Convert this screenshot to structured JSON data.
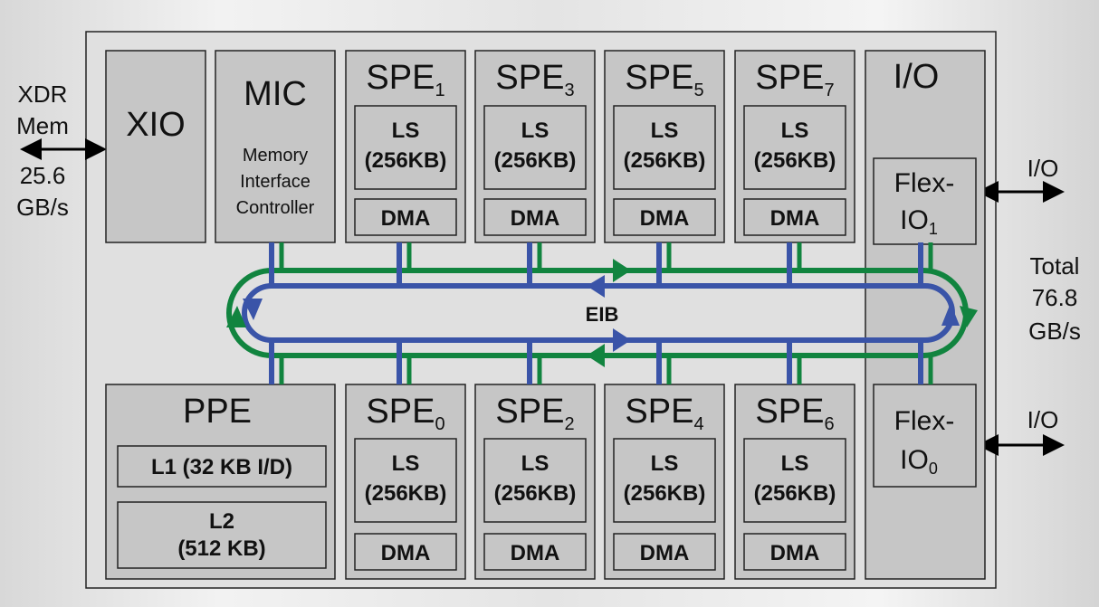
{
  "left": {
    "line1": "XDR",
    "line2": "Mem",
    "line3": "25.6",
    "line4": "GB/s"
  },
  "right": {
    "io_top": "I/O",
    "io_bottom": "I/O",
    "total1": "Total",
    "total2": "76.8",
    "total3": "GB/s"
  },
  "xio": "XIO",
  "mic": {
    "title": "MIC",
    "line1": "Memory",
    "line2": "Interface",
    "line3": "Controller"
  },
  "spe_prefix": "SPE",
  "spes_top": [
    "1",
    "3",
    "5",
    "7"
  ],
  "spes_bottom": [
    "0",
    "2",
    "4",
    "6"
  ],
  "ls": {
    "line1": "LS",
    "line2": "(256KB)"
  },
  "dma": "DMA",
  "io": {
    "title": "I/O",
    "flex": "Flex-",
    "io": "IO",
    "sub_top": "1",
    "sub_bottom": "0"
  },
  "ppe": {
    "title": "PPE",
    "l1": "L1 (32 KB I/D)",
    "l2_line1": "L2",
    "l2_line2": "(512 KB)"
  },
  "eib": "EIB",
  "colors": {
    "ring_blue": "#3a54a8",
    "ring_green": "#11843f",
    "box": "#c6c6c6",
    "chip": "#e0e0e0"
  }
}
